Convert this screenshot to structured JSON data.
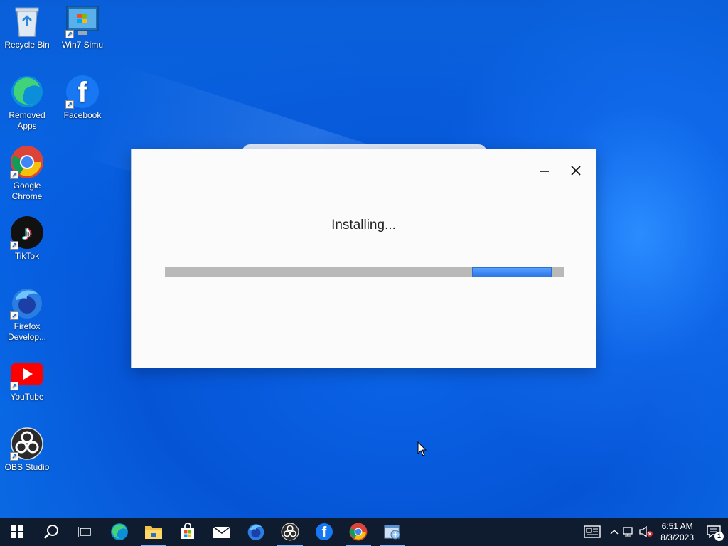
{
  "desktop": {
    "icons": [
      {
        "label": "Recycle Bin"
      },
      {
        "label": "Win7 Simu"
      },
      {
        "label": "Removed Apps"
      },
      {
        "label": "Facebook"
      },
      {
        "label": "Google Chrome"
      },
      {
        "label": "TikTok"
      },
      {
        "label": "Firefox Develop..."
      },
      {
        "label": "YouTube"
      },
      {
        "label": "OBS Studio"
      }
    ]
  },
  "dialog": {
    "status_text": "Installing...",
    "progress_segment_start": 0.77,
    "progress_segment_end": 0.97
  },
  "taskbar": {
    "apps": [
      "start-icon",
      "search-icon",
      "task-view-icon",
      "edge-icon",
      "file-explorer-icon",
      "store-icon",
      "mail-icon",
      "firefox-icon",
      "obs-icon",
      "facebook-icon",
      "chrome-icon",
      "installer-icon"
    ],
    "clock_time": "6:51 AM",
    "clock_date": "8/3/2023",
    "notification_count": "1"
  },
  "colors": {
    "progress_fill": "#3b86f0",
    "progress_track": "#b9b9b9",
    "taskbar_bg": "#0f1b2e"
  }
}
